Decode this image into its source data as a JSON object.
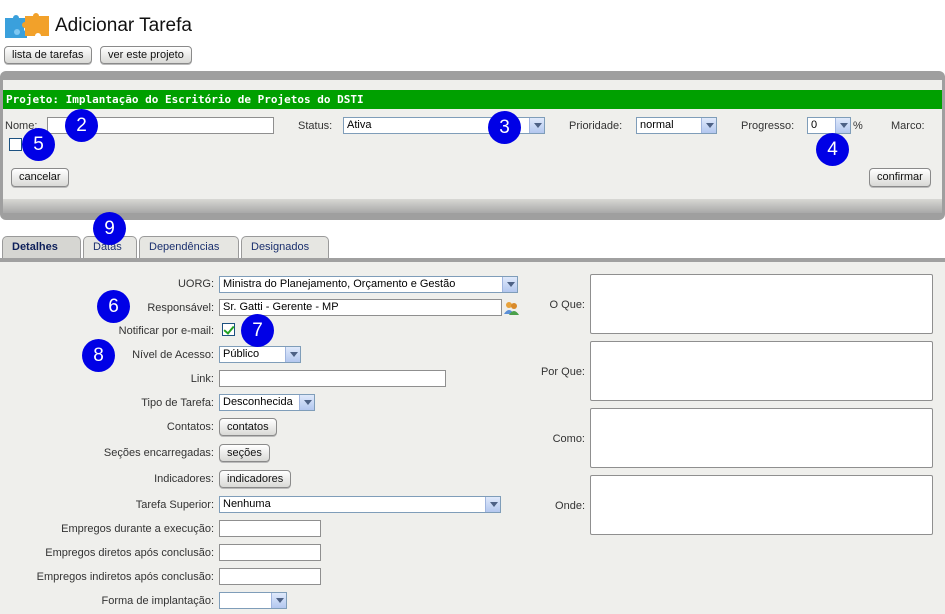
{
  "header": {
    "title": "Adicionar Tarefa",
    "buttons": {
      "task_list": "lista de tarefas",
      "view_project": "ver este projeto"
    }
  },
  "project_panel": {
    "project_title": "Projeto: Implantação do Escritório de Projetos do DSTI",
    "name_label": "Nome:",
    "name_value": "",
    "status_label": "Status:",
    "status_value": "Ativa",
    "priority_label": "Prioridade:",
    "priority_value": "normal",
    "progress_label": "Progresso:",
    "progress_value": "0",
    "progress_unit": "%",
    "milestone_label": "Marco:",
    "milestone_checked": false,
    "cancel": "cancelar",
    "confirm": "confirmar"
  },
  "tabs": [
    "Detalhes",
    "Datas",
    "Dependências",
    "Designados"
  ],
  "details": {
    "uorg_label": "UORG:",
    "uorg_value": "Ministra do Planejamento, Orçamento e Gestão",
    "responsible_label": "Responsável:",
    "responsible_value": "Sr. Gatti - Gerente - MP",
    "notify_label": "Notificar por e-mail:",
    "notify_checked": true,
    "access_label": "Nível de Acesso:",
    "access_value": "Público",
    "link_label": "Link:",
    "link_value": "",
    "task_type_label": "Tipo de Tarefa:",
    "task_type_value": "Desconhecida",
    "contacts_label": "Contatos:",
    "contacts_button": "contatos",
    "sections_label": "Seções encarregadas:",
    "sections_button": "seções",
    "indicators_label": "Indicadores:",
    "indicators_button": "indicadores",
    "parent_task_label": "Tarefa Superior:",
    "parent_task_value": "Nenhuma",
    "jobs_during_label": "Empregos durante a execução:",
    "jobs_direct_label": "Empregos diretos após conclusão:",
    "jobs_indirect_label": "Empregos indiretos após conclusão:",
    "implementation_label": "Forma de implantação:",
    "implementation_value": ""
  },
  "questions": {
    "what": "O Que:",
    "why": "Por Que:",
    "how": "Como:",
    "where": "Onde:"
  },
  "markers": [
    "2",
    "3",
    "4",
    "5",
    "6",
    "7",
    "8",
    "9"
  ],
  "colors": {
    "project_bar": "#00a000",
    "marker": "#0000e6",
    "tab_text": "#1a2f6e"
  },
  "icons": {
    "logo": "puzzle-pieces-icon",
    "contacts_picker": "users-icon"
  }
}
